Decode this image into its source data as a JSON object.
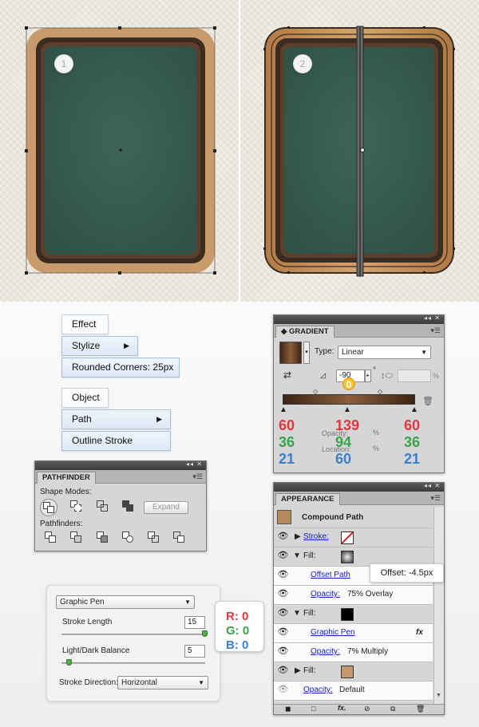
{
  "artboard": {
    "badges": [
      "1",
      "2"
    ],
    "colors": {
      "background": "#ece7dd",
      "felt": "#3a5f52",
      "wood": "#c99b6a",
      "frame_dark": "#3b2c22"
    }
  },
  "menus": {
    "effect": {
      "label": "Effect",
      "stylize": "Stylize",
      "rounded": "Rounded Corners: 25px"
    },
    "object": {
      "label": "Object",
      "path": "Path",
      "outline": "Outline Stroke"
    }
  },
  "pathfinder": {
    "title": "PATHFINDER",
    "shape_modes": "Shape Modes:",
    "expand": "Expand",
    "pathfinders": "Pathfinders:"
  },
  "gradient": {
    "title": "GRADIENT",
    "type_label": "Type:",
    "type_value": "Linear",
    "angle_value": "-90",
    "angle_unit": "°",
    "marker_badge": "0",
    "opacity_label": "Opacity:",
    "location_label": "Location:",
    "percent": "%",
    "stops": [
      {
        "r": "60",
        "g": "36",
        "b": "21"
      },
      {
        "r": "139",
        "g": "94",
        "b": "60"
      },
      {
        "r": "60",
        "g": "36",
        "b": "21"
      }
    ]
  },
  "appearance": {
    "title": "APPEARANCE",
    "header": "Compound Path",
    "rows": [
      {
        "kind": "stroke",
        "label": "Stroke:"
      },
      {
        "kind": "fill",
        "label": "Fill:"
      },
      {
        "kind": "effect",
        "label": "Offset Path"
      },
      {
        "kind": "opacity",
        "label": "Opacity:",
        "value": "75% Overlay"
      },
      {
        "kind": "fill",
        "label": "Fill:"
      },
      {
        "kind": "effect",
        "label": "Graphic Pen"
      },
      {
        "kind": "opacity",
        "label": "Opacity:",
        "value": "7% Multiply"
      },
      {
        "kind": "fill",
        "label": "Fill:"
      },
      {
        "kind": "opacity",
        "label": "Opacity:",
        "value": "Default"
      }
    ],
    "tooltip": "Offset: -4.5px"
  },
  "graphic_pen": {
    "filter": "Graphic Pen",
    "stroke_length_label": "Stroke Length",
    "stroke_length_value": "15",
    "balance_label": "Light/Dark Balance",
    "balance_value": "5",
    "direction_label": "Stroke Direction:",
    "direction_value": "Horizontal"
  },
  "rgb_badge": {
    "r": "R: 0",
    "g": "G: 0",
    "b": "B: 0"
  }
}
